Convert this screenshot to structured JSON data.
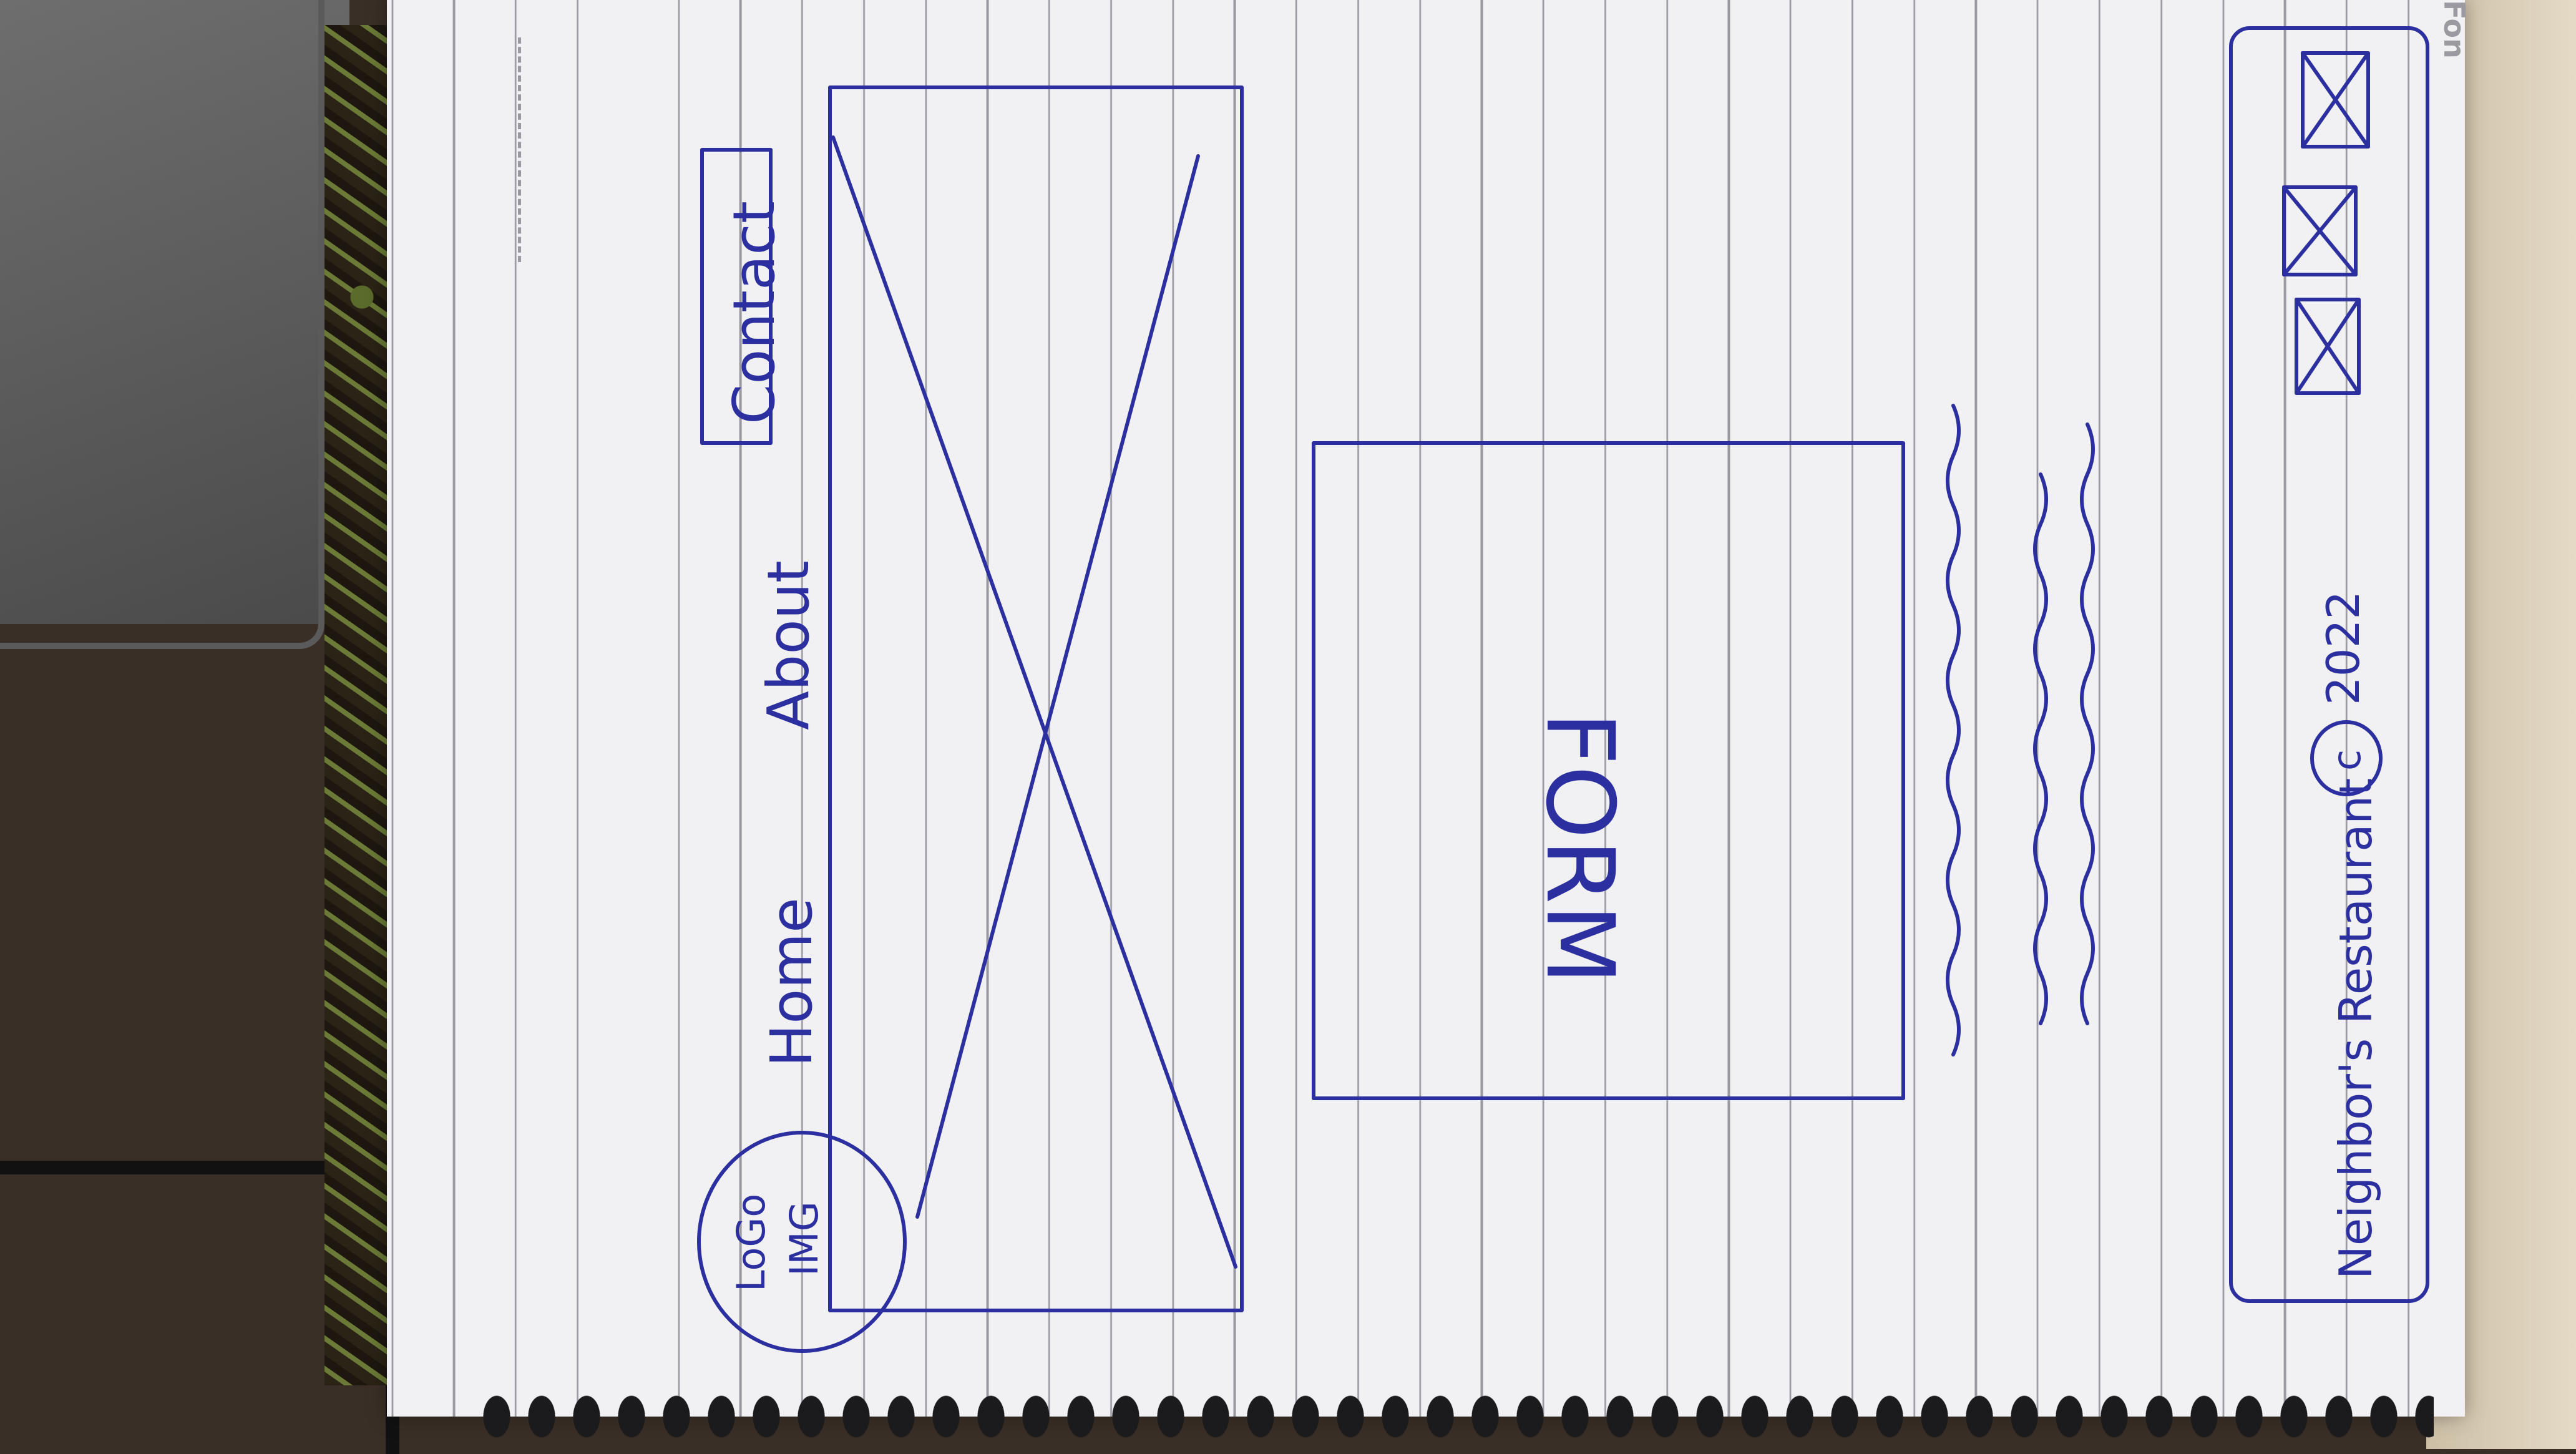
{
  "sketch": {
    "nav": {
      "logo_line1": "LoGo",
      "logo_line2": "IMG",
      "home": "Home",
      "about": "About",
      "contact": "Contact"
    },
    "form_label": "FORM",
    "footer": {
      "text": "Neighbor's Restaurant",
      "copyright_symbol": "c",
      "year": "2022"
    },
    "corner_text": "Fon"
  },
  "colors": {
    "ink": "#2b2fa0",
    "paper": "#f1f0f3",
    "rule_lines": "#9a99a2"
  }
}
